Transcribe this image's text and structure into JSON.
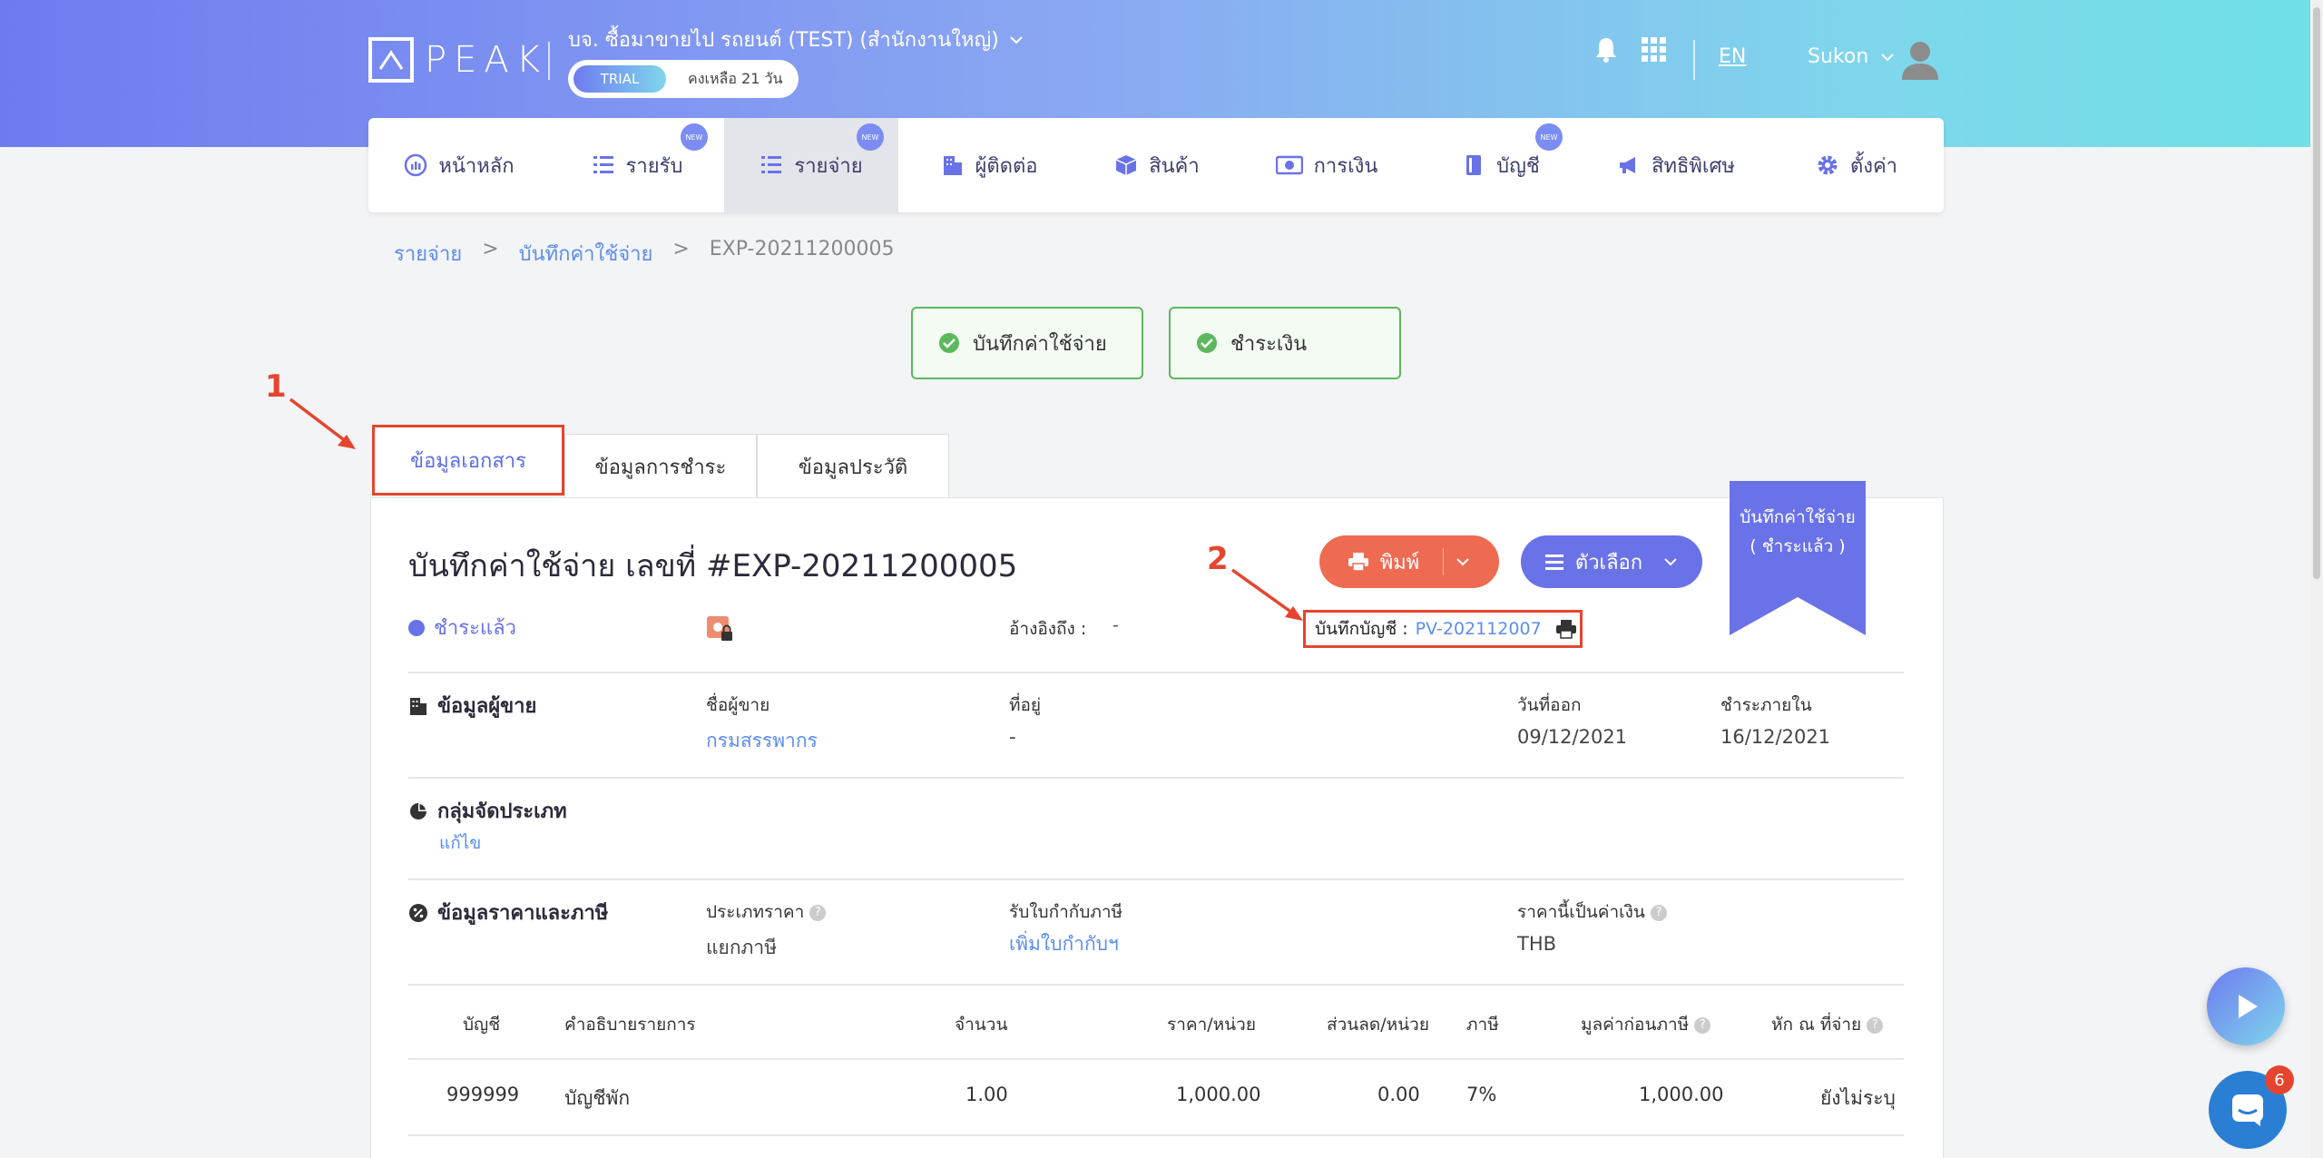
{
  "header": {
    "logo_text": "PEAK",
    "company": "บจ. ซื้อมาขายไป รถยนต์ (TEST) (สำนักงานใหญ่)",
    "trial_label": "TRIAL",
    "trial_remaining": "คงเหลือ 21 วัน",
    "language": "EN",
    "user": "Sukon"
  },
  "nav": {
    "items": [
      {
        "label": "หน้าหลัก",
        "icon": "chart-icon",
        "new": false
      },
      {
        "label": "รายรับ",
        "icon": "list-icon",
        "new": true
      },
      {
        "label": "รายจ่าย",
        "icon": "list-icon",
        "new": true,
        "active": true
      },
      {
        "label": "ผู้ติดต่อ",
        "icon": "building-icon",
        "new": false
      },
      {
        "label": "สินค้า",
        "icon": "box-icon",
        "new": false
      },
      {
        "label": "การเงิน",
        "icon": "money-icon",
        "new": false
      },
      {
        "label": "บัญชี",
        "icon": "ledger-icon",
        "new": true
      },
      {
        "label": "สิทธิพิเศษ",
        "icon": "megaphone-icon",
        "new": false
      },
      {
        "label": "ตั้งค่า",
        "icon": "gear-icon",
        "new": false
      }
    ],
    "new_badge": "NEW"
  },
  "breadcrumb": {
    "root": "รายจ่าย",
    "mid": "บันทึกค่าใช้จ่าย",
    "current": "EXP-20211200005",
    "sep": ">"
  },
  "steps": {
    "step1": "บันทึกค่าใช้จ่าย",
    "step2": "ชำระเงิน"
  },
  "annotations": {
    "one": "1",
    "two": "2"
  },
  "tabs": {
    "doc_info": "ข้อมูลเอกสาร",
    "payment_info": "ข้อมูลการชำระ",
    "history": "ข้อมูลประวัติ"
  },
  "document": {
    "title": "บันทึกค่าใช้จ่าย เลขที่ #EXP-20211200005",
    "print_label": "พิมพ์",
    "options_label": "ตัวเลือก",
    "ribbon_line1": "บันทึกค่าใช้จ่าย",
    "ribbon_line2": "( ชำระแล้ว )",
    "status": "ชำระแล้ว",
    "ref_label": "อ้างอิงถึง :",
    "ref_value": "-",
    "gl_label": "บันทึกบัญชี :",
    "gl_value": "PV-202112007"
  },
  "vendor": {
    "section": "ข้อมูลผู้ขาย",
    "name_label": "ชื่อผู้ขาย",
    "name": "กรมสรรพากร",
    "address_label": "ที่อยู่",
    "address": "-",
    "issue_label": "วันที่ออก",
    "issue_date": "09/12/2021",
    "due_label": "ชำระภายใน",
    "due_date": "16/12/2021"
  },
  "category": {
    "section": "กลุ่มจัดประเภท",
    "edit": "แก้ไข"
  },
  "pricing": {
    "section": "ข้อมูลราคาและภาษี",
    "price_type_label": "ประเภทราคา",
    "price_type": "แยกภาษี",
    "tax_invoice_label": "รับใบกำกับภาษี",
    "tax_invoice_link": "เพิ่มใบกำกับฯ",
    "currency_label": "ราคานี้เป็นค่าเงิน",
    "currency": "THB"
  },
  "table": {
    "headers": [
      "บัญชี",
      "คำอธิบายรายการ",
      "จำนวน",
      "ราคา/หน่วย",
      "ส่วนลด/หน่วย",
      "ภาษี",
      "มูลค่าก่อนภาษี",
      "หัก ณ ที่จ่าย"
    ],
    "rows": [
      [
        "999999",
        "บัญชีพัก",
        "1.00",
        "1,000.00",
        "0.00",
        "7%",
        "1,000.00",
        "ยังไม่ระบุ"
      ]
    ]
  },
  "chat": {
    "badge": "6"
  },
  "colors": {
    "accent": "#6a72e8",
    "print": "#ee6b51",
    "annotation": "#e5452e",
    "success": "#5cb85c",
    "link": "#5b8def"
  }
}
